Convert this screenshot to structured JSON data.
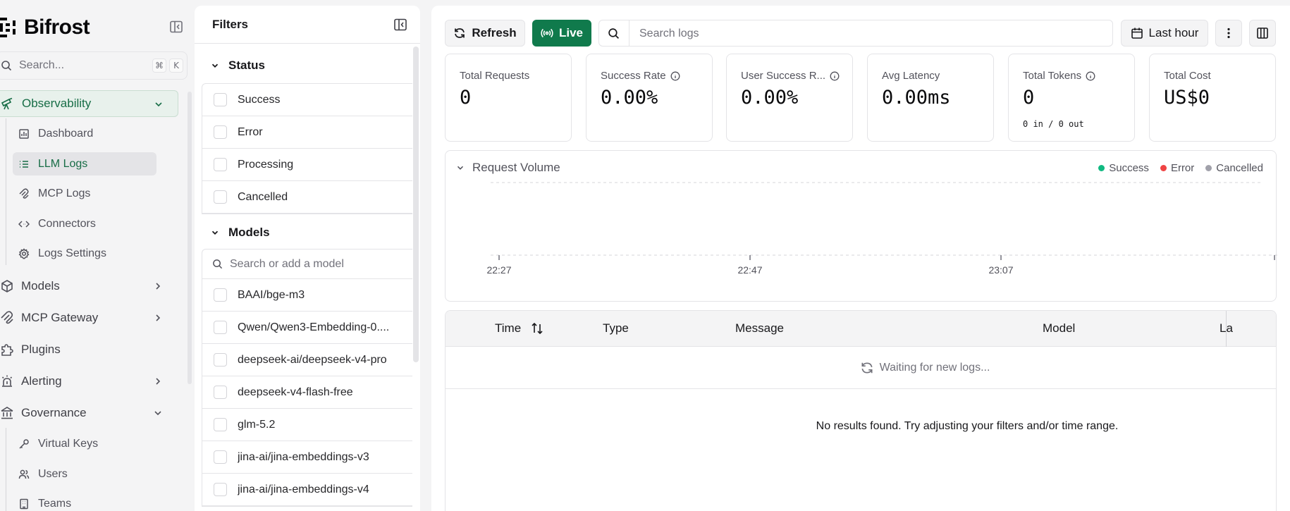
{
  "app": {
    "brand": "Bifrost"
  },
  "nav": {
    "search": {
      "placeholder": "Search...",
      "shortcut_mod": "⌘",
      "shortcut_key": "K"
    },
    "groups": {
      "observability": "Observability",
      "models": "Models",
      "mcp_gateway": "MCP Gateway",
      "plugins": "Plugins",
      "alerting": "Alerting",
      "governance": "Governance"
    },
    "observability_items": {
      "dashboard": "Dashboard",
      "llm_logs": "LLM Logs",
      "mcp_logs": "MCP Logs",
      "connectors": "Connectors",
      "logs_settings": "Logs Settings"
    },
    "governance_items": {
      "virtual_keys": "Virtual Keys",
      "users": "Users",
      "teams": "Teams"
    }
  },
  "filters": {
    "title": "Filters",
    "status": {
      "title": "Status",
      "items": [
        "Success",
        "Error",
        "Processing",
        "Cancelled"
      ]
    },
    "models": {
      "title": "Models",
      "search_placeholder": "Search or add a model",
      "items": [
        "BAAI/bge-m3",
        "Qwen/Qwen3-Embedding-0....",
        "deepseek-ai/deepseek-v4-pro",
        "deepseek-v4-flash-free",
        "glm-5.2",
        "jina-ai/jina-embeddings-v3",
        "jina-ai/jina-embeddings-v4"
      ]
    }
  },
  "toolbar": {
    "refresh": "Refresh",
    "live": "Live",
    "search_placeholder": "Search logs",
    "time_range": "Last hour"
  },
  "stats": {
    "total_requests": {
      "label": "Total Requests",
      "value": "0"
    },
    "success_rate": {
      "label": "Success Rate",
      "value": "0.00%"
    },
    "user_success_rate": {
      "label": "User Success R...",
      "value": "0.00%"
    },
    "avg_latency": {
      "label": "Avg Latency",
      "value": "0.00ms"
    },
    "total_tokens": {
      "label": "Total Tokens",
      "value": "0",
      "sub": "0 in / 0 out"
    },
    "total_cost": {
      "label": "Total Cost",
      "value": "US$0"
    }
  },
  "chart_data": {
    "type": "bar",
    "title": "Request Volume",
    "x": [
      "22:27",
      "22:47",
      "23:07"
    ],
    "series": [
      {
        "name": "Success",
        "values": [
          0,
          0,
          0
        ],
        "color": "#10b981"
      },
      {
        "name": "Error",
        "values": [
          0,
          0,
          0
        ],
        "color": "#ef4444"
      },
      {
        "name": "Cancelled",
        "values": [
          0,
          0,
          0
        ],
        "color": "#a1a1aa"
      }
    ],
    "legend_position": "top-right",
    "grid": true
  },
  "table": {
    "columns": [
      "Time",
      "Type",
      "Message",
      "Model",
      "La"
    ],
    "waiting": "Waiting for new logs...",
    "empty": "No results found. Try adjusting your filters and/or time range."
  },
  "colors": {
    "accent": "#107a4c",
    "success": "#10b981",
    "error": "#ef4444",
    "cancelled": "#a1a1aa"
  }
}
